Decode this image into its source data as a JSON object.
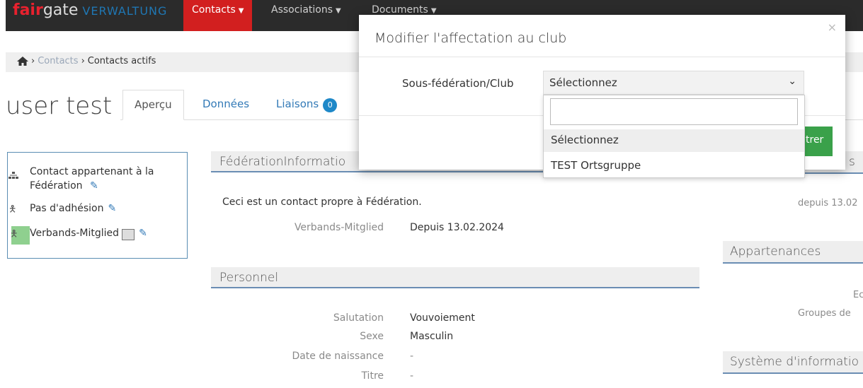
{
  "nav": {
    "logo_fair": "fair",
    "logo_gate": "gate",
    "logo_sub": "VERWALTUNG",
    "items": [
      "Contacts",
      "Associations",
      "Documents"
    ]
  },
  "breadcrumb": {
    "link": "Contacts",
    "current": "Contacts actifs"
  },
  "page": {
    "title": "user test"
  },
  "tabs": {
    "overview": "Aperçu",
    "data": "Données",
    "links": "Liaisons",
    "links_count": "0"
  },
  "left_panel": {
    "items": [
      "Contact appartenant à la Fédération",
      "Pas d'adhésion",
      "Verbands-Mitglied"
    ]
  },
  "main": {
    "section1_title": "FédérationInformatio",
    "note": "Ceci est un contact propre à Fédération.",
    "membership_label": "Verbands-Mitglied",
    "membership_value": "Depuis 13.02.2024",
    "section2_title": "Personnel",
    "fields": [
      {
        "label": "Salutation",
        "value": "Vouvoiement"
      },
      {
        "label": "Sexe",
        "value": "Masculin"
      },
      {
        "label": "Date de naissance",
        "value": "-"
      },
      {
        "label": "Titre",
        "value": "-"
      }
    ]
  },
  "right": {
    "since_text": "depuis 13.02",
    "section_belongings": "Appartenances",
    "ec_text": "Ec",
    "groups_text": "Groupes de",
    "section_system": "Système d'informatio",
    "partial_top": "s"
  },
  "modal": {
    "title": "Modifier l'affectation au club",
    "close": "×",
    "field_label": "Sous-fédération/Club",
    "select_value": "Sélectionnez",
    "save_partial": "trer",
    "options": [
      "Sélectionnez",
      "TEST Ortsgruppe"
    ]
  },
  "colors": {
    "nav_bg": "#2b2b2b",
    "nav_active": "#d21f1f",
    "accent_blue": "#337ab7",
    "save_green": "#3aa14a"
  }
}
